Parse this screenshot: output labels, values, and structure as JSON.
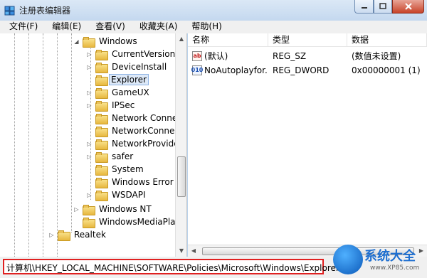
{
  "window": {
    "title": "注册表编辑器"
  },
  "menu": [
    "文件(F)",
    "编辑(E)",
    "查看(V)",
    "收藏夹(A)",
    "帮助(H)"
  ],
  "tree": {
    "nodes": [
      {
        "label": "Windows",
        "expander": "collapse"
      },
      {
        "label": "CurrentVersion",
        "expander": "expand"
      },
      {
        "label": "DeviceInstall",
        "expander": "expand"
      },
      {
        "label": "Explorer",
        "expander": "",
        "selected": true
      },
      {
        "label": "GameUX",
        "expander": "expand"
      },
      {
        "label": "IPSec",
        "expander": "expand"
      },
      {
        "label": "Network Connecti",
        "expander": ""
      },
      {
        "label": "NetworkConnectiv",
        "expander": ""
      },
      {
        "label": "NetworkProvider",
        "expander": "expand"
      },
      {
        "label": "safer",
        "expander": "expand"
      },
      {
        "label": "System",
        "expander": ""
      },
      {
        "label": "Windows Error Re",
        "expander": ""
      },
      {
        "label": "WSDAPI",
        "expander": "expand"
      },
      {
        "label": "Windows NT",
        "expander": "expand"
      },
      {
        "label": "WindowsMediaPlaye",
        "expander": ""
      },
      {
        "label": "Realtek",
        "expander": "expand"
      }
    ]
  },
  "values": {
    "columns": [
      "名称",
      "类型",
      "数据"
    ],
    "rows": [
      {
        "icon": "ab",
        "name": "(默认)",
        "type": "REG_SZ",
        "data": "(数值未设置)"
      },
      {
        "icon": "010",
        "name": "NoAutoplayfor...",
        "type": "REG_DWORD",
        "data": "0x00000001 (1)"
      }
    ]
  },
  "status": {
    "path": "计算机\\HKEY_LOCAL_MACHINE\\SOFTWARE\\Policies\\Microsoft\\Windows\\Explorer"
  },
  "watermark": {
    "title": "系统大全",
    "url": "www.XP85.com"
  },
  "colors": {
    "highlight": "#e02020",
    "selection": "#dde9f8"
  }
}
